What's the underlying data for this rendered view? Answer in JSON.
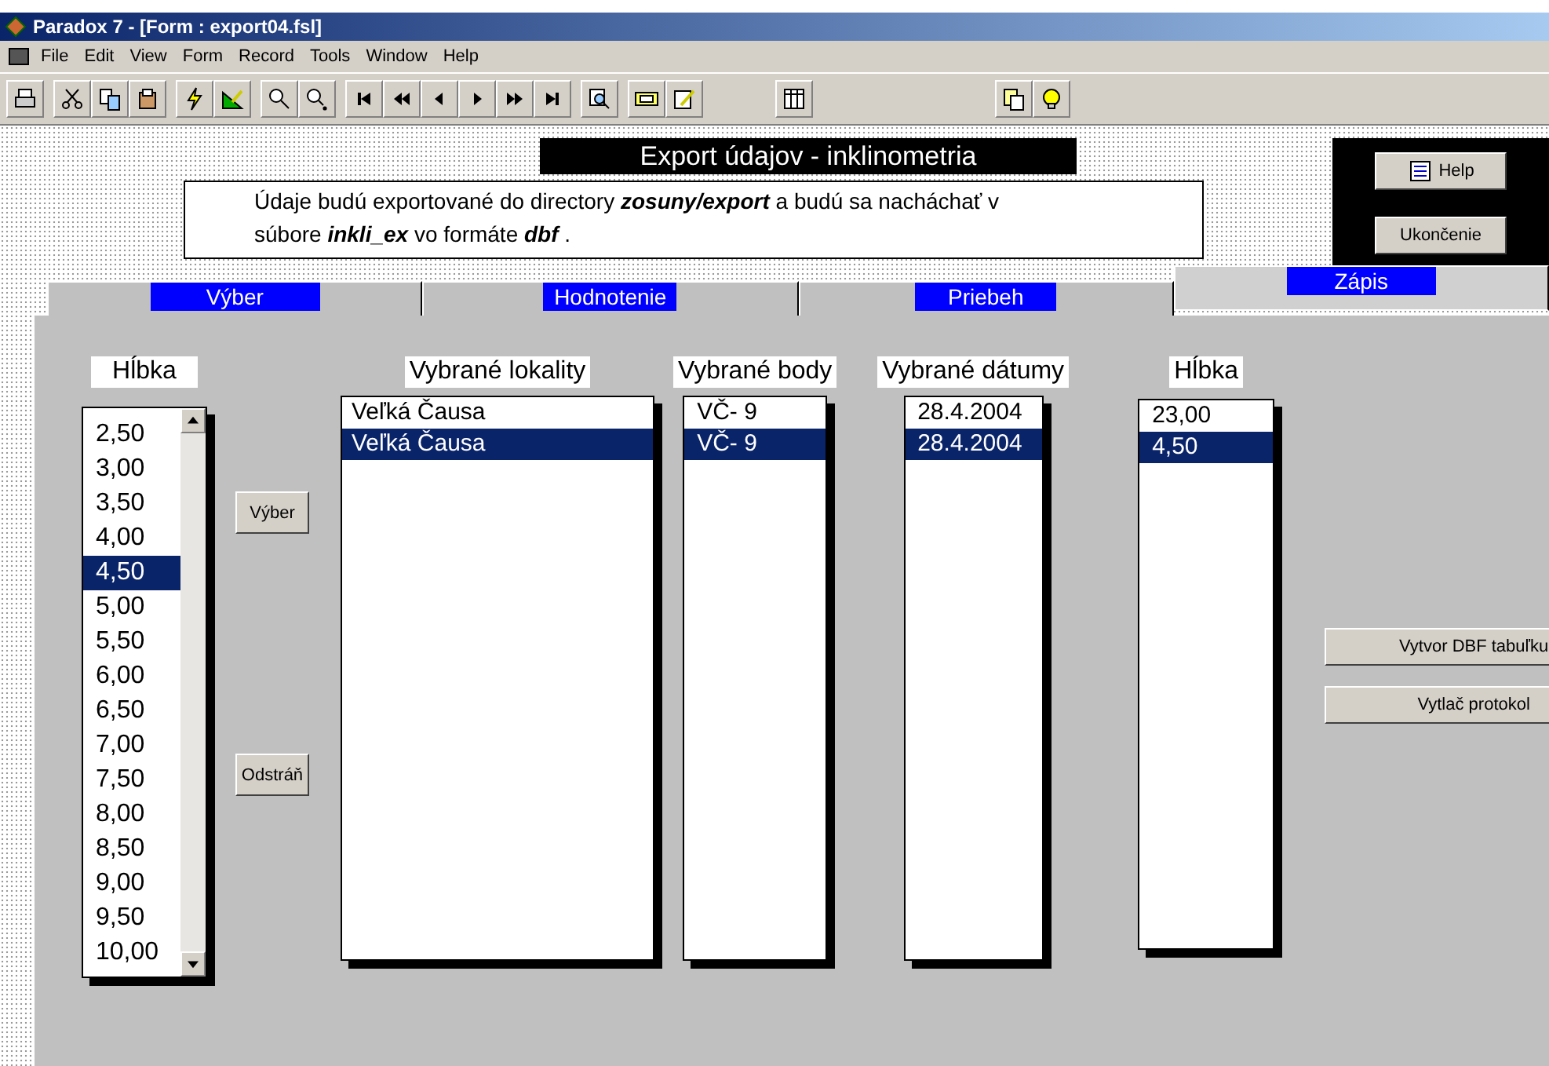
{
  "window": {
    "title": "Paradox 7 - [Form : export04.fsl]"
  },
  "menu": [
    "File",
    "Edit",
    "View",
    "Form",
    "Record",
    "Tools",
    "Window",
    "Help"
  ],
  "form": {
    "title": "Export údajov - inklinometria",
    "info_lines": [
      "Údaje budú exportované do directory **zosuny/export**  a budú sa nacháchať v",
      "súbore **inkli_ex**  vo formáte **dbf** ."
    ],
    "side_buttons": [
      "Help",
      "Ukončenie"
    ],
    "tabs": [
      {
        "label": "Výber",
        "selected": false
      },
      {
        "label": "Hodnotenie",
        "selected": false
      },
      {
        "label": "Priebeh",
        "selected": false
      },
      {
        "label": "Zápis",
        "selected": true
      }
    ],
    "depth_list": {
      "label": "Hĺbka",
      "items": [
        {
          "text": "2,50",
          "selected": false
        },
        {
          "text": "3,00",
          "selected": false
        },
        {
          "text": "3,50",
          "selected": false
        },
        {
          "text": "4,00",
          "selected": false
        },
        {
          "text": "4,50",
          "selected": true
        },
        {
          "text": "5,00",
          "selected": false
        },
        {
          "text": "5,50",
          "selected": false
        },
        {
          "text": "6,00",
          "selected": false
        },
        {
          "text": "6,50",
          "selected": false
        },
        {
          "text": "7,00",
          "selected": false
        },
        {
          "text": "7,50",
          "selected": false
        },
        {
          "text": "8,00",
          "selected": false
        },
        {
          "text": "8,50",
          "selected": false
        },
        {
          "text": "9,00",
          "selected": false
        },
        {
          "text": "9,50",
          "selected": false
        },
        {
          "text": "10,00",
          "selected": false
        }
      ]
    },
    "move_buttons": [
      "Výber",
      "Odstráň"
    ],
    "lists": [
      {
        "label": "Vybrané lokality",
        "items": [
          {
            "text": "Veľká Čausa",
            "selected": false
          },
          {
            "text": "Veľká Čausa",
            "selected": true
          }
        ]
      },
      {
        "label": "Vybrané body",
        "items": [
          {
            "text": "VČ- 9",
            "selected": false
          },
          {
            "text": "VČ- 9",
            "selected": true
          }
        ]
      },
      {
        "label": "Vybrané dátumy",
        "items": [
          {
            "text": "28.4.2004",
            "selected": false
          },
          {
            "text": "28.4.2004",
            "selected": true
          }
        ]
      },
      {
        "label": "Hĺbka",
        "items": [
          {
            "text": "23,00",
            "selected": false
          },
          {
            "text": "4,50",
            "selected": true
          }
        ]
      }
    ],
    "action_buttons": [
      "Vytvor DBF tabuľku",
      "Vytlač protokol"
    ]
  }
}
